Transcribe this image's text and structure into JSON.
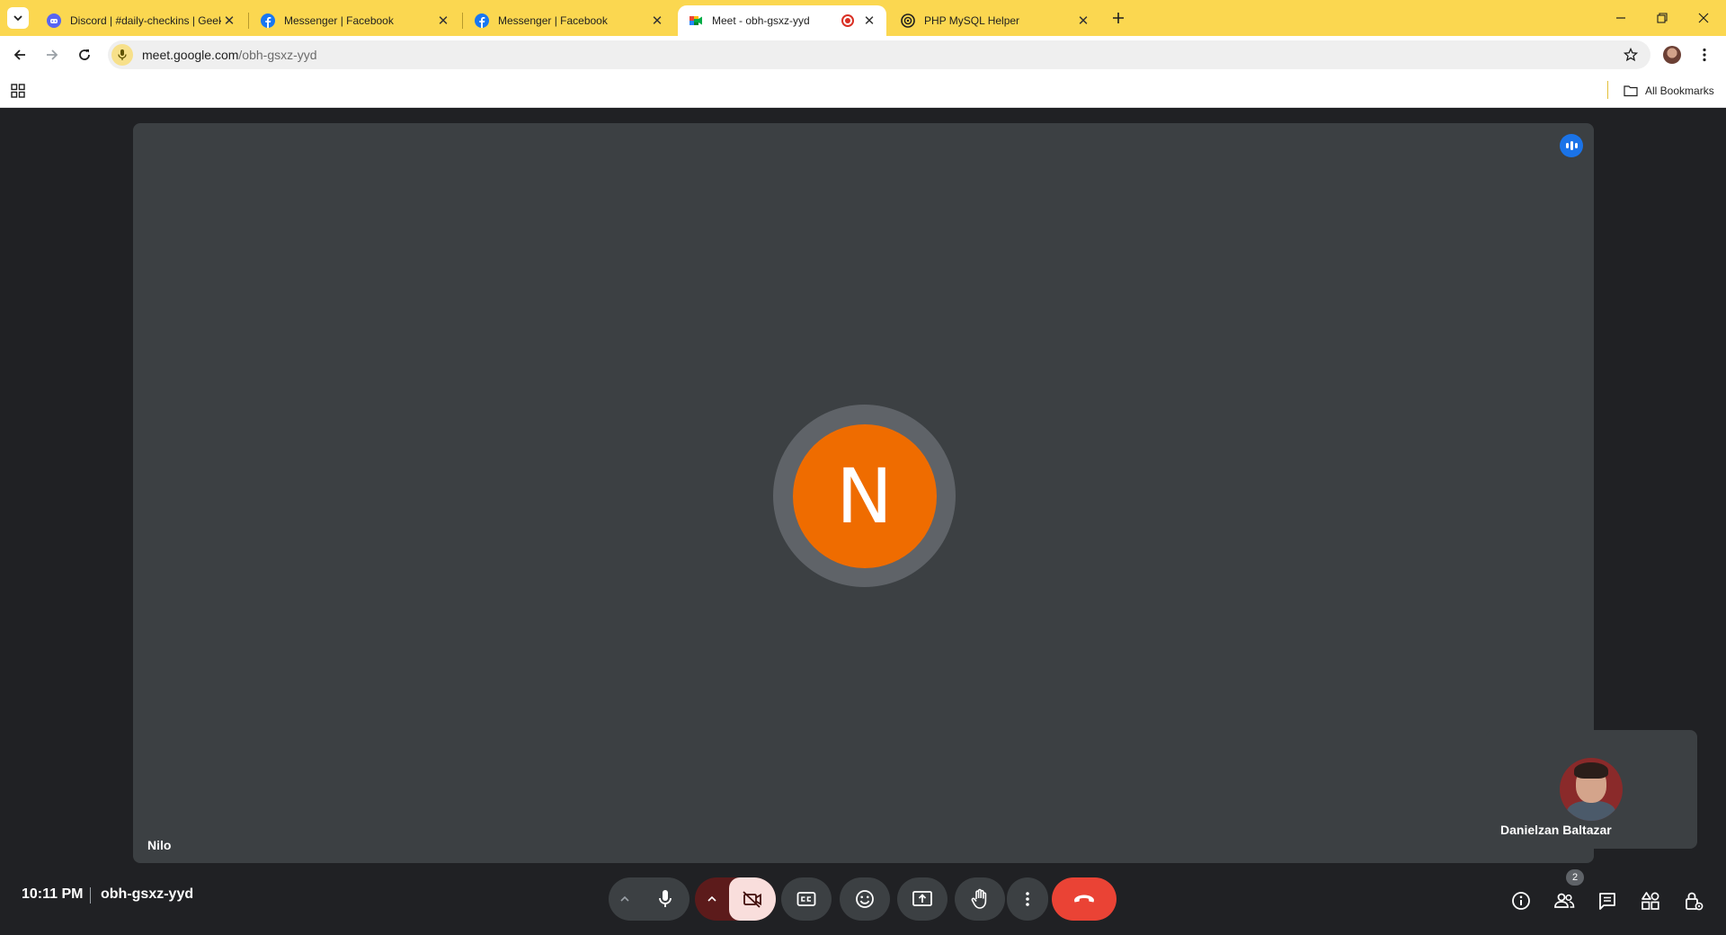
{
  "browser": {
    "tabs": [
      {
        "title": "Discord | #daily-checkins | Geek",
        "icon": "discord-icon"
      },
      {
        "title": "Messenger | Facebook",
        "icon": "facebook-icon"
      },
      {
        "title": "Messenger | Facebook",
        "icon": "facebook-icon"
      },
      {
        "title": "Meet - obh-gsxz-yyd",
        "icon": "google-meet-icon",
        "active": true,
        "recording": true
      },
      {
        "title": "PHP MySQL Helper",
        "icon": "openai-icon"
      }
    ],
    "url_host": "meet.google.com",
    "url_path": "/obh-gsxz-yyd",
    "bookmarks_label": "All Bookmarks",
    "accent": "#fbd750"
  },
  "meet": {
    "main_participant": {
      "name": "Nilo",
      "initial": "N",
      "avatar_color": "#ef6c00",
      "speaking": true
    },
    "self_participant": {
      "name": "Danielzan Baltazar"
    },
    "time": "10:11 PM",
    "meeting_code": "obh-gsxz-yyd",
    "people_count": "2",
    "controls": [
      "chevron-up-icon",
      "microphone-icon",
      "chevron-up-icon",
      "camera-off-icon",
      "captions-icon",
      "emoji-icon",
      "present-screen-icon",
      "raise-hand-icon",
      "more-options-icon",
      "end-call-icon"
    ],
    "right_controls": [
      "info-icon",
      "people-icon",
      "chat-icon",
      "activities-icon",
      "host-controls-icon"
    ],
    "colors": {
      "end_call": "#ea4335",
      "camera_off_bg": "#f9dedc",
      "tile": "#3c4043",
      "background": "#202124"
    }
  }
}
